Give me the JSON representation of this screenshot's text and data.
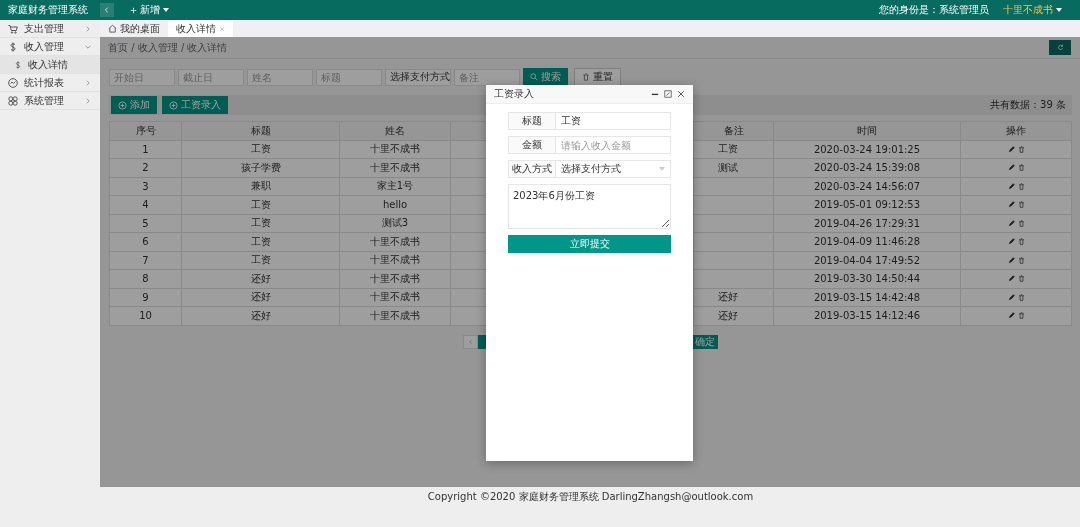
{
  "header": {
    "title": "家庭财务管理系统",
    "new_menu": "新增",
    "identity": "您的身份是：系统管理员",
    "user": "十里不成书"
  },
  "sidebar": {
    "items": [
      {
        "label": "支出管理",
        "expanded": false
      },
      {
        "label": "收入管理",
        "expanded": true,
        "children": [
          {
            "label": "收入详情",
            "selected": true
          }
        ]
      },
      {
        "label": "统计报表",
        "expanded": false
      },
      {
        "label": "系统管理",
        "expanded": false
      }
    ]
  },
  "tabs": [
    {
      "label": "我的桌面",
      "selected": false
    },
    {
      "label": "收入详情",
      "selected": true
    }
  ],
  "breadcrumb": "首页 / 收入管理 / 收入详情",
  "filters": [
    {
      "placeholder": "开始日"
    },
    {
      "placeholder": "截止日"
    },
    {
      "placeholder": "姓名"
    },
    {
      "placeholder": "标题"
    },
    {
      "kind": "select",
      "value": "选择支付方式"
    },
    {
      "placeholder": "备注"
    }
  ],
  "search_button": "搜索",
  "reset_button": "重置",
  "toolbar": {
    "buttons": [
      "添加",
      "工资录入"
    ],
    "total": "共有数据：39 条"
  },
  "table": {
    "columns": [
      "序号",
      "标题",
      "姓名",
      "备注",
      "时间",
      "操作"
    ],
    "rows": [
      {
        "index": "1",
        "title": "工资",
        "name": "十里不成书",
        "note": "工资",
        "time": "2020-03-24 19:01:25"
      },
      {
        "index": "2",
        "title": "孩子学费",
        "name": "十里不成书",
        "note": "测试",
        "time": "2020-03-24 15:39:08"
      },
      {
        "index": "3",
        "title": "兼职",
        "name": "家主1号",
        "time": "2020-03-24 14:56:07"
      },
      {
        "index": "4",
        "title": "工资",
        "name": "hello",
        "time": "2019-05-01 09:12:53"
      },
      {
        "index": "5",
        "title": "工资",
        "name": "测试3",
        "time": "2019-04-26 17:29:31"
      },
      {
        "index": "6",
        "title": "工资",
        "name": "十里不成书",
        "time": "2019-04-09 11:46:28"
      },
      {
        "index": "7",
        "title": "工资",
        "name": "十里不成书",
        "time": "2019-04-04 17:49:52"
      },
      {
        "index": "8",
        "title": "还好",
        "name": "十里不成书",
        "time": "2019-03-30 14:50:44"
      },
      {
        "index": "9",
        "title": "还好",
        "name": "十里不成书",
        "note": "还好",
        "time": "2019-03-15 14:42:48"
      },
      {
        "index": "10",
        "title": "还好",
        "name": "十里不成书",
        "note": "还好",
        "time": "2019-03-15 14:12:46"
      }
    ]
  },
  "pagination": {
    "confirm": "确定"
  },
  "modal": {
    "title": "工资录入",
    "fields": [
      {
        "label": "标题",
        "value": "工资"
      },
      {
        "label": "金额",
        "placeholder": "请输入收入金额"
      },
      {
        "label": "收入方式",
        "kind": "select",
        "value": "选择支付方式"
      }
    ],
    "textarea": "2023年6月份工资",
    "submit": "立即提交"
  },
  "footer": "Copyright ©2020 家庭财务管理系统 DarlingZhangsh@outlook.com"
}
